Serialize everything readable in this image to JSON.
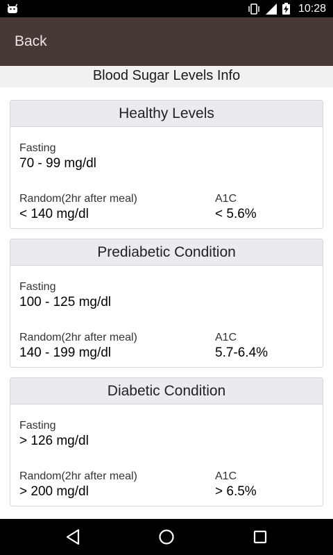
{
  "status_bar": {
    "time": "10:28",
    "icons": [
      "android-icon",
      "vibrate-icon",
      "signal-icon",
      "battery-charging-icon"
    ]
  },
  "app_bar": {
    "back_label": "Back"
  },
  "page_title": "Blood Sugar Levels Info",
  "cards": [
    {
      "title": "Healthy Levels",
      "fasting_label": "Fasting",
      "fasting_value": "70 - 99 mg/dl",
      "random_label": "Random(2hr after meal)",
      "random_value": "< 140 mg/dl",
      "a1c_label": "A1C",
      "a1c_value": "< 5.6%"
    },
    {
      "title": "Prediabetic Condition",
      "fasting_label": "Fasting",
      "fasting_value": "100 - 125 mg/dl",
      "random_label": "Random(2hr after meal)",
      "random_value": "140 - 199 mg/dl",
      "a1c_label": "A1C",
      "a1c_value": "5.7-6.4%"
    },
    {
      "title": "Diabetic Condition",
      "fasting_label": "Fasting",
      "fasting_value": "> 126 mg/dl",
      "random_label": "Random(2hr after meal)",
      "random_value": "> 200 mg/dl",
      "a1c_label": "A1C",
      "a1c_value": "> 6.5%"
    }
  ],
  "nav_bar": {
    "icons": [
      "back-triangle-icon",
      "home-circle-icon",
      "recents-square-icon"
    ]
  },
  "colors": {
    "app_bar": "#473a36",
    "card_header": "#e9ebf1",
    "status_bar": "#000000"
  }
}
